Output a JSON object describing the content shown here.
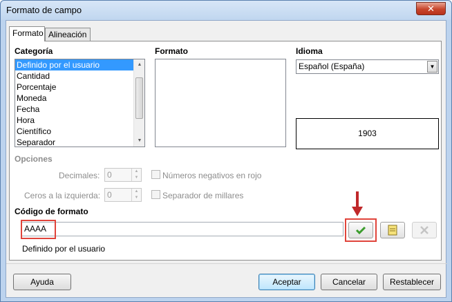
{
  "window": {
    "title": "Formato de campo",
    "close_glyph": "✕"
  },
  "tabs": [
    {
      "label": "Formato",
      "active": true
    },
    {
      "label": "Alineación",
      "active": false
    }
  ],
  "categoria": {
    "heading": "Categoría",
    "items": [
      "Definido por el usuario",
      "Cantidad",
      "Porcentaje",
      "Moneda",
      "Fecha",
      "Hora",
      "Científico",
      "Separador"
    ],
    "selected_index": 0
  },
  "formato": {
    "heading": "Formato",
    "items": []
  },
  "idioma": {
    "heading": "Idioma",
    "value": "Español (España)"
  },
  "preview": {
    "value": "1903"
  },
  "opciones": {
    "heading": "Opciones",
    "decimales_label": "Decimales:",
    "decimales_value": "0",
    "ceros_label": "Ceros a la izquierda:",
    "ceros_value": "0",
    "negativos_label": "Números negativos en rojo",
    "separador_label": "Separador de millares"
  },
  "codigo": {
    "heading": "Código de formato",
    "value": "AAAA",
    "description": "Definido por el usuario"
  },
  "buttons": {
    "help": "Ayuda",
    "ok": "Aceptar",
    "cancel": "Cancelar",
    "reset": "Restablecer"
  },
  "colors": {
    "highlight": "#e0433a",
    "selection": "#3399ff",
    "check_green": "#3b9c2c",
    "arrow": "#c0282a"
  }
}
